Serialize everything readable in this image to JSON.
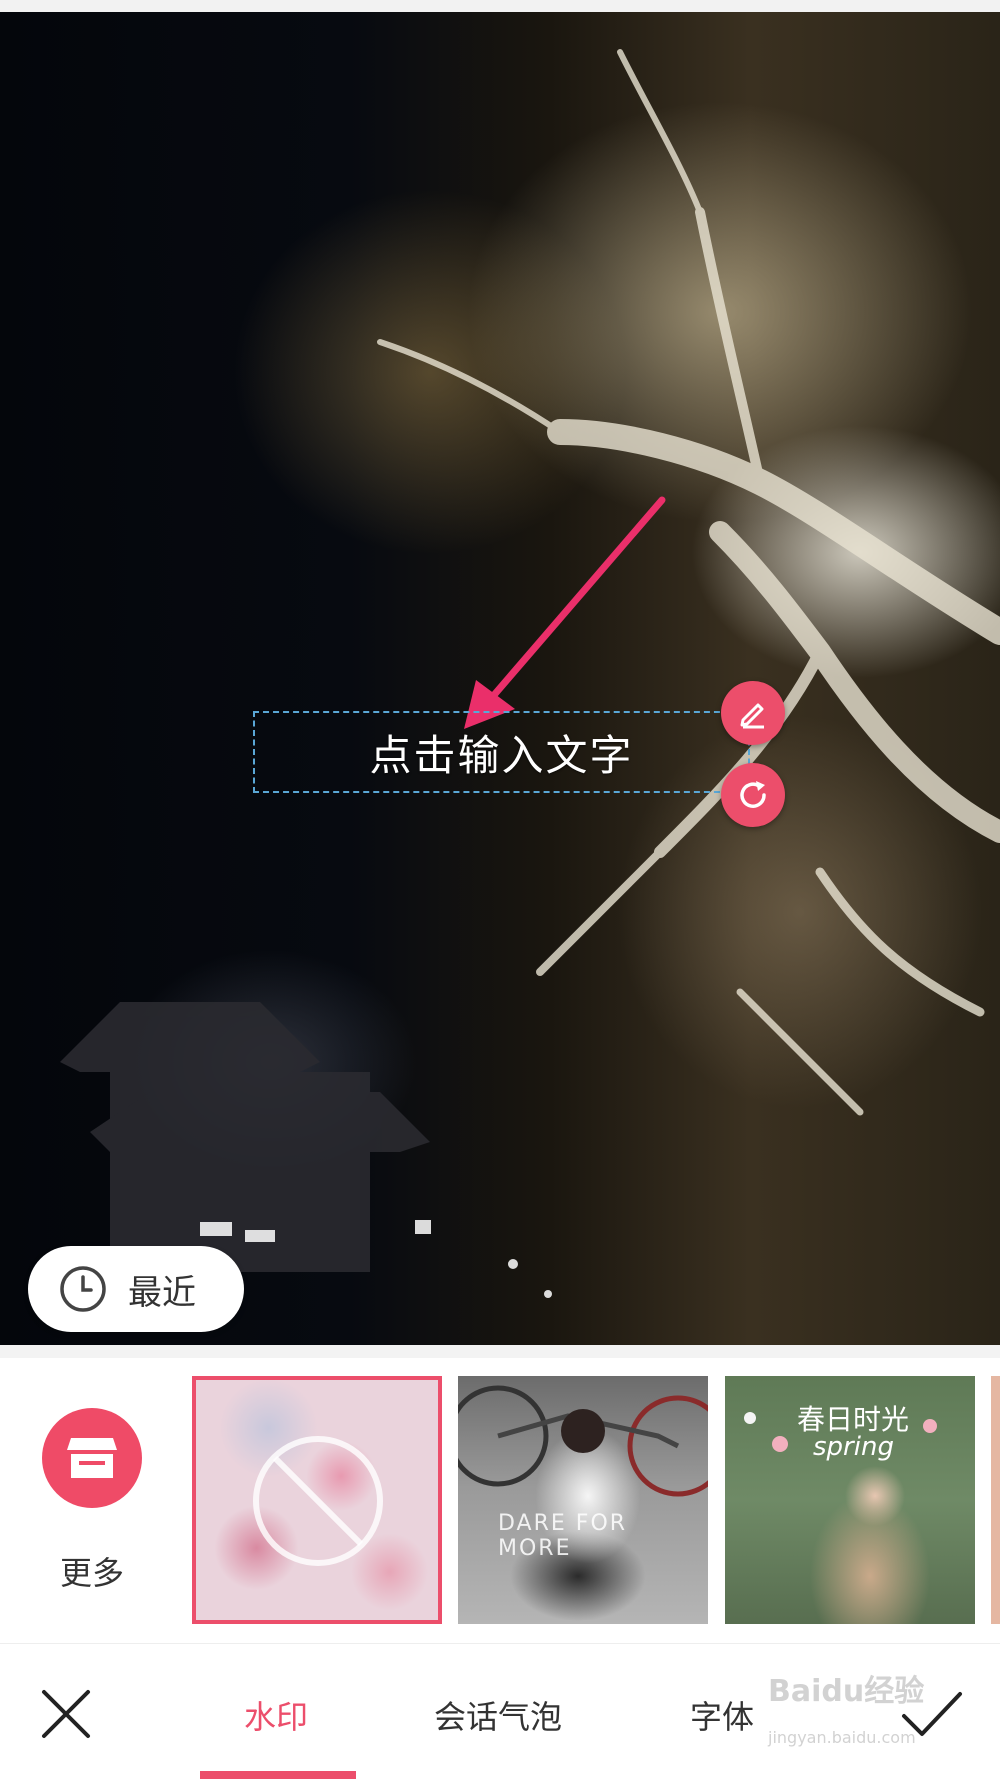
{
  "canvas": {
    "sticker_text": "点击输入文字"
  },
  "recent": {
    "label": "最近"
  },
  "strip": {
    "more_label": "更多",
    "templates": [
      {
        "name": "none",
        "overlay_text": ""
      },
      {
        "name": "bike",
        "overlay_text": "DARE FOR MORE"
      },
      {
        "name": "spring",
        "overlay_text": "春日时光",
        "overlay_subtext": "spring"
      }
    ]
  },
  "tabs": [
    {
      "label": "水印",
      "active": true
    },
    {
      "label": "会话气泡",
      "active": false
    },
    {
      "label": "字体",
      "active": false
    }
  ],
  "watermark": {
    "logo": "Baidu经验",
    "url": "jingyan.baidu.com"
  },
  "colors": {
    "accent": "#ec4e6b",
    "selection_border": "#5aa7d6"
  }
}
